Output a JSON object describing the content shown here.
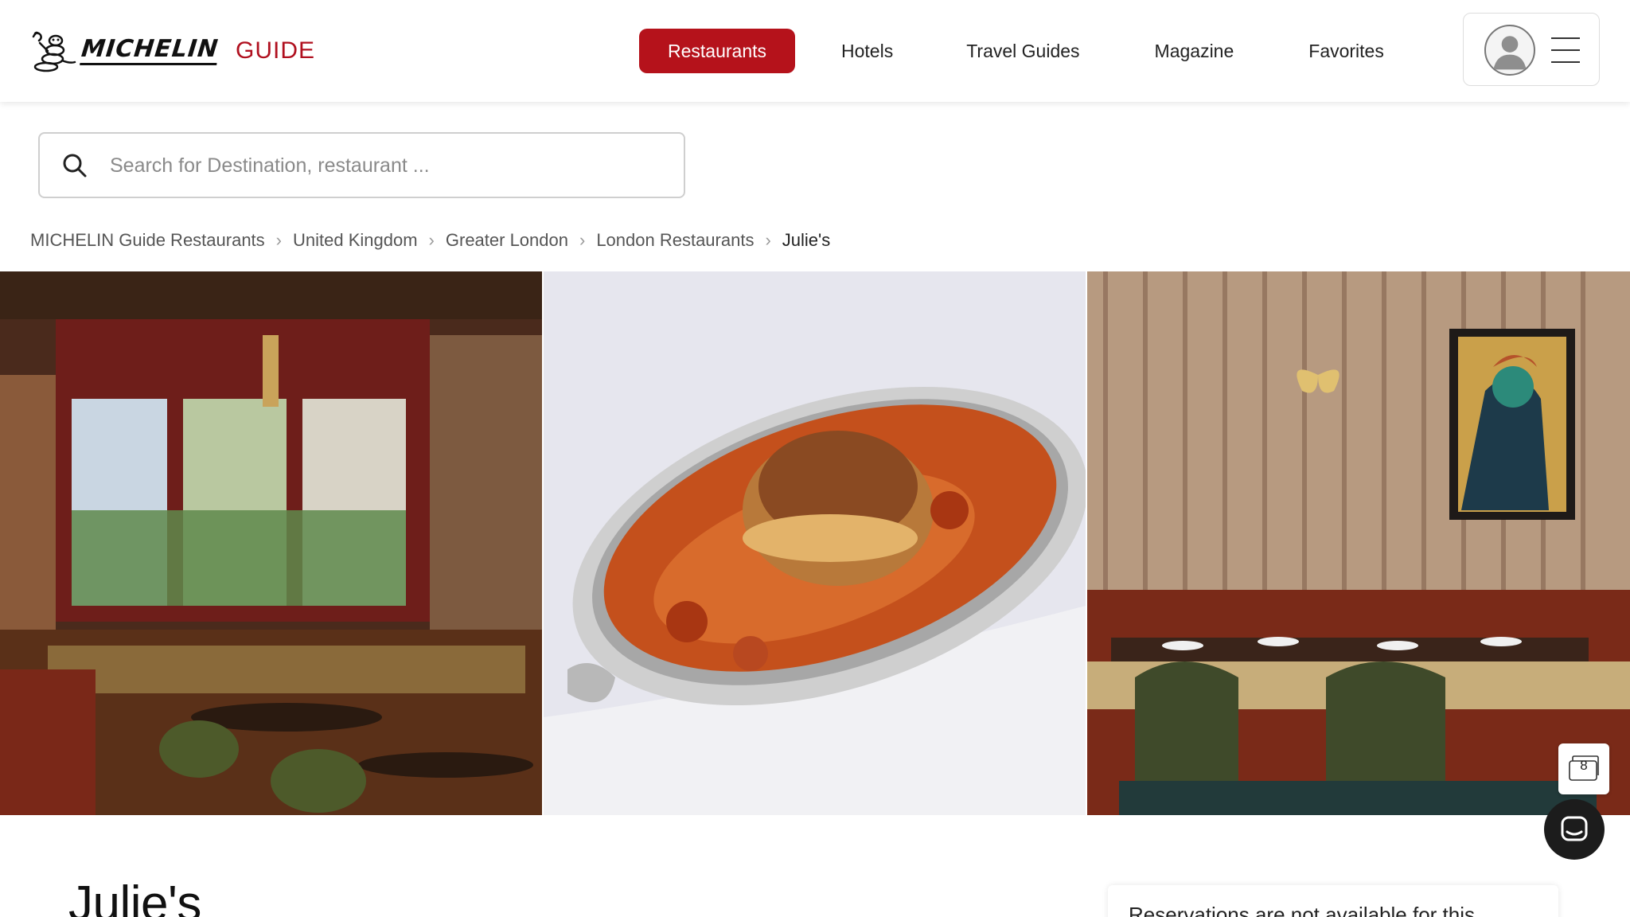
{
  "brand": {
    "wordmark": "MICHELIN",
    "guide": "GUIDE",
    "accent": "#b5121b"
  },
  "nav": {
    "items": [
      {
        "label": "Restaurants",
        "active": true
      },
      {
        "label": "Hotels",
        "active": false
      },
      {
        "label": "Travel Guides",
        "active": false
      },
      {
        "label": "Magazine",
        "active": false
      },
      {
        "label": "Favorites",
        "active": false
      }
    ]
  },
  "user": {
    "avatar_icon": "user-avatar-icon",
    "menu_icon": "hamburger-menu-icon"
  },
  "search": {
    "placeholder": "Search for Destination, restaurant ...",
    "value": ""
  },
  "breadcrumb": [
    "MICHELIN Guide Restaurants",
    "United Kingdom",
    "Greater London",
    "London Restaurants",
    "Julie's"
  ],
  "gallery": {
    "photo_count": "8"
  },
  "restaurant": {
    "name": "Julie's"
  },
  "reservation": {
    "text": "Reservations are not available for this"
  }
}
